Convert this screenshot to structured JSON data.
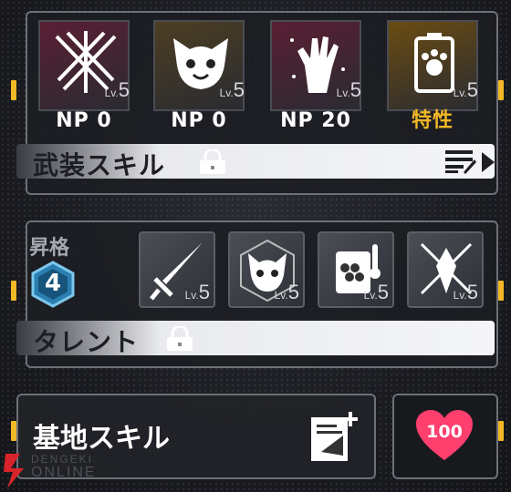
{
  "np_cards": [
    {
      "name": "crossed-claws-icon",
      "level_prefix": "Lv.",
      "level": "5",
      "label": "NP 0",
      "tint": "#5a1f34"
    },
    {
      "name": "cat-face-icon",
      "level_prefix": "Lv.",
      "level": "5",
      "label": "NP 0",
      "tint": "#4c3e22"
    },
    {
      "name": "grabbing-hand-icon",
      "level_prefix": "Lv.",
      "level": "5",
      "label": "NP 20",
      "tint": "#5a1f34"
    },
    {
      "name": "battery-paw-icon",
      "level_prefix": "Lv.",
      "level": "5",
      "label": "特性",
      "tint": "#6a4c12"
    }
  ],
  "armed_skill": {
    "title": "武装スキル",
    "icons": [
      "lock-icon",
      "list-edit-icon",
      "play-arrow-icon"
    ]
  },
  "ascension": {
    "label": "昇格",
    "value": "4"
  },
  "talents": [
    {
      "name": "sword-icon",
      "level_prefix": "Lv.",
      "level": "5"
    },
    {
      "name": "cat-emblem-icon",
      "level_prefix": "Lv.",
      "level": "5"
    },
    {
      "name": "thermo-hex-icon",
      "level_prefix": "Lv.",
      "level": "5"
    },
    {
      "name": "crossed-sparkle-icon",
      "level_prefix": "Lv.",
      "level": "5"
    }
  ],
  "talent_bar": {
    "title": "タレント"
  },
  "base_skill": {
    "title": "基地スキル"
  },
  "affinity": {
    "value": "100"
  },
  "watermark": {
    "line1": "DENGEKI",
    "line2": "ONLINE"
  },
  "colors": {
    "accent": "#f2b825",
    "trait_text": "#f2b825",
    "heart": "#ff3f6e"
  }
}
